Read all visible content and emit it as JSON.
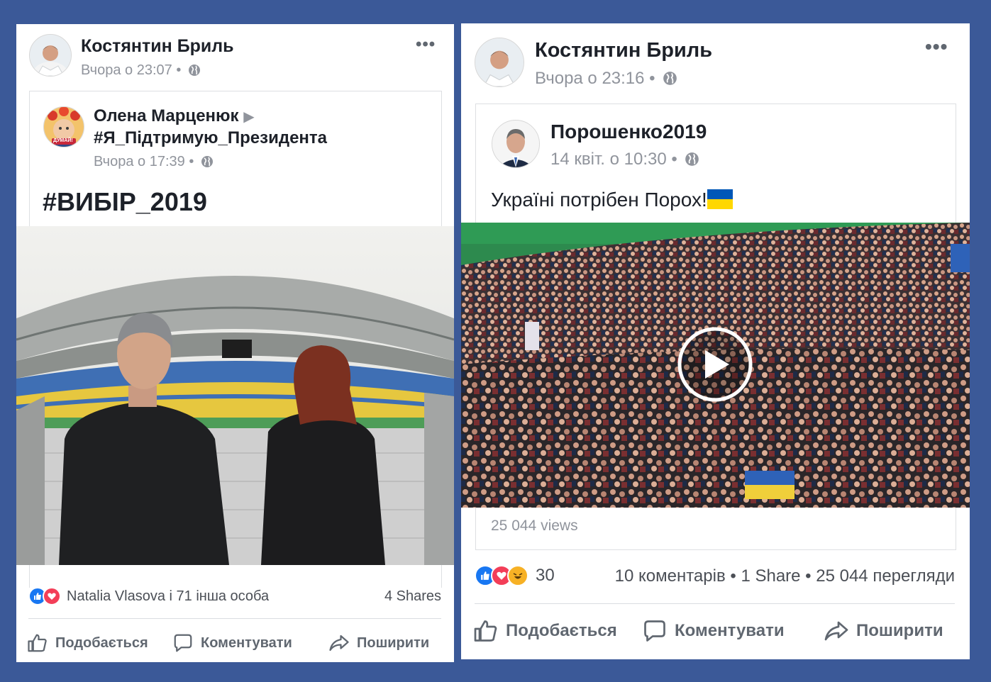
{
  "left_post": {
    "author": "Костянтин Бриль",
    "time": "Вчора о 23:07",
    "shared": {
      "author": "Олена Марценюк",
      "page": "#Я_Підтримую_Президента",
      "time": "Вчора о 17:39",
      "avatar_badge": "ДУМАЙ!",
      "text": "#ВИБІР_2019"
    },
    "reactions_text": "Natalia Vlasova і 71 інша особа",
    "shares": "4 Shares",
    "actions": {
      "like": "Подобається",
      "comment": "Коментувати",
      "share": "Поширити"
    }
  },
  "right_post": {
    "author": "Костянтин Бриль",
    "time": "Вчора о 23:16",
    "shared": {
      "author": "Порошенко2019",
      "time": "14 квіт. о 10:30",
      "text": "Україні потрібен Порох!"
    },
    "video_views": "25 044 views",
    "reaction_count": "30",
    "stats": "10 коментарів • 1 Share • 25 044 перегляди",
    "actions": {
      "like": "Подобається",
      "comment": "Коментувати",
      "share": "Поширити"
    }
  },
  "colors": {
    "page_background": "#3b5998",
    "like_blue": "#1877f2",
    "love_red": "#f33e58",
    "haha_yellow": "#f7b125",
    "flag_blue": "#0057b7",
    "flag_yellow": "#ffd700"
  },
  "icons": [
    "globe-icon",
    "more-options-icon",
    "play-icon",
    "like-icon",
    "love-icon",
    "haha-icon",
    "comment-icon",
    "share-icon"
  ]
}
